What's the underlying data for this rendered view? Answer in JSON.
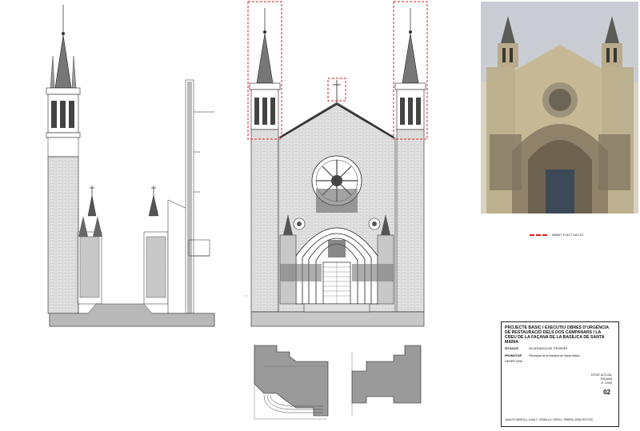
{
  "legend": {
    "label": "ÀMBIT D'ACTUACIÓ",
    "color": "#d42020"
  },
  "title_block": {
    "project": "PROJECTE BÀSIC I EXECUTIU OBRES D'URGÈNCIA DE RESTAURACIÓ DELS DOS CAMPANARS I LA CREU DE LA FAÇANA DE LA BASÍLICA DE SANTA MARIA",
    "situacio_key": "SITUACIÓ",
    "situacio_value": "VILAFRANCA DEL PENEDÈS",
    "promotor_key": "PROMOTOR",
    "promotor_value": "Parròquia de la Basílica de Santa Maria",
    "date": "GENER 2008",
    "sheet_title": "ESTAT ACTUAL",
    "sheet_subtitle": "FAÇANA",
    "scale": "E: 1/100",
    "sheet_number": "02",
    "authors": "JOAN FIGUEROLA, JOAN C. GRAELLS i JORDI J. RIBERA, ARQUITECTES"
  },
  "colors": {
    "line": "#1a1a1a",
    "masonry": "#d9d9d9",
    "section": "#9a9a9a",
    "highlight": "#d42020"
  }
}
